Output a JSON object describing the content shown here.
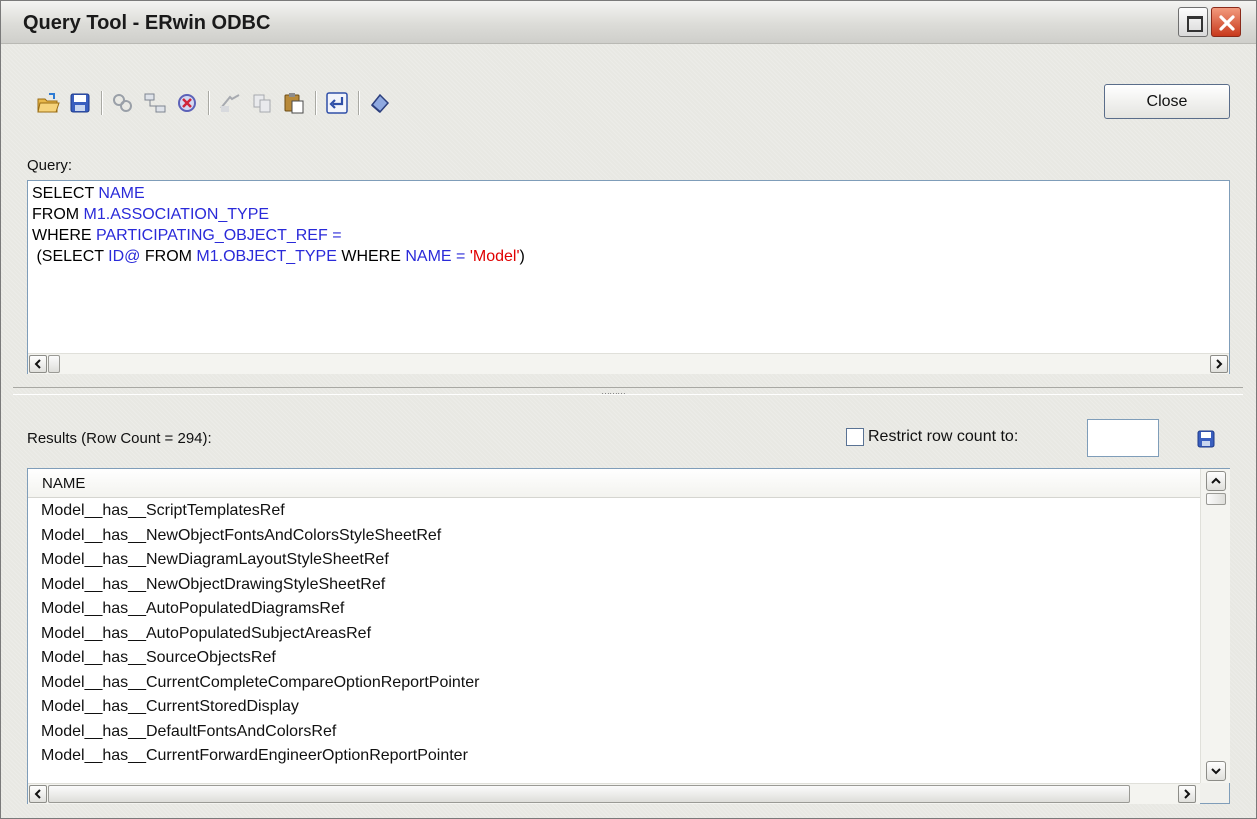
{
  "window": {
    "title": "Query Tool - ERwin ODBC",
    "close_button_label": "Close"
  },
  "toolbar": {
    "icons": [
      "open-file-icon",
      "save-icon",
      "join-icon",
      "relationship-icon",
      "delete-query-icon",
      "execute-icon",
      "copy-icon",
      "paste-icon",
      "word-wrap-icon",
      "clear-icon"
    ]
  },
  "query": {
    "label": "Query:",
    "line1": {
      "kw": "SELECT ",
      "obj": "NAME"
    },
    "line2": {
      "kw": "FROM ",
      "obj": "M1.ASSOCIATION_TYPE"
    },
    "line3": {
      "kw": "WHERE ",
      "obj": "PARTICIPATING_OBJECT_REF ="
    },
    "line4": {
      "kw1": " (SELECT ",
      "obj1": "ID@",
      "kw2": " FROM ",
      "obj2": "M1.OBJECT_TYPE",
      "kw3": " WHERE ",
      "obj3": "NAME =",
      "str": " 'Model'",
      "kw4": ")"
    }
  },
  "results": {
    "label": "Results (Row Count = 294):",
    "restrict_label": "Restrict row count to:",
    "restrict_value": "",
    "restrict_checked": false,
    "column_header": "NAME",
    "rows": [
      "Model__has__ScriptTemplatesRef",
      "Model__has__NewObjectFontsAndColorsStyleSheetRef",
      "Model__has__NewDiagramLayoutStyleSheetRef",
      "Model__has__NewObjectDrawingStyleSheetRef",
      "Model__has__AutoPopulatedDiagramsRef",
      "Model__has__AutoPopulatedSubjectAreasRef",
      "Model__has__SourceObjectsRef",
      "Model__has__CurrentCompleteCompareOptionReportPointer",
      "Model__has__CurrentStoredDisplay",
      "Model__has__DefaultFontsAndColorsRef",
      "Model__has__CurrentForwardEngineerOptionReportPointer"
    ]
  },
  "colors": {
    "keyword": "#000000",
    "object": "#2a2ad9",
    "string": "#e00000"
  }
}
